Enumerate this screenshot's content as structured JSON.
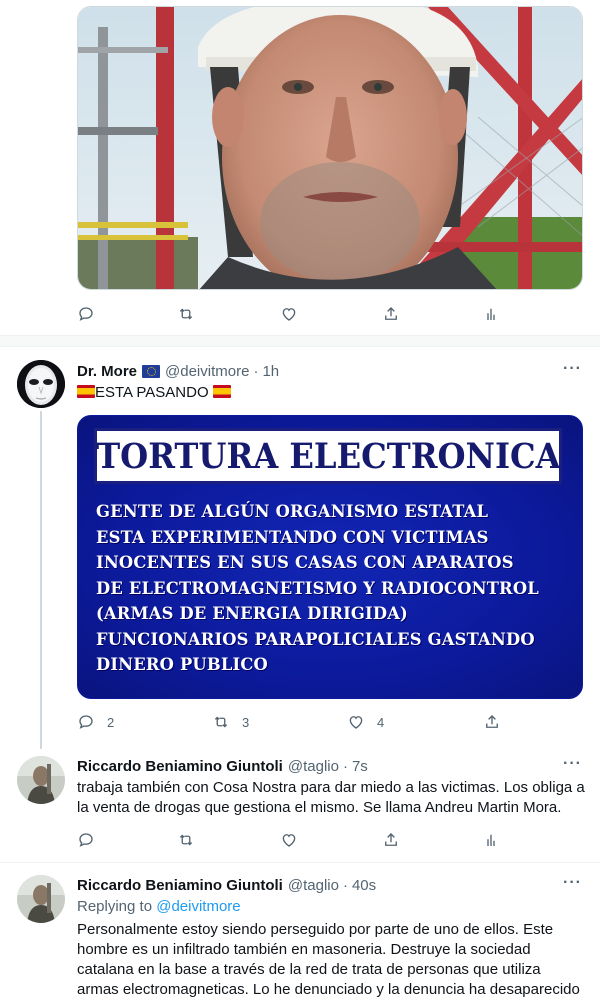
{
  "tweet_top": {
    "photo": "selfie-man-with-hardhat-near-antenna-tower",
    "actions": {
      "reply": "",
      "retweet": "",
      "like": ""
    }
  },
  "tweet_main": {
    "name": "Dr. More",
    "handle": "@deivitmore",
    "time": "1h",
    "text": "ESTA PASANDO",
    "image": {
      "title": "TORTURA ELECTRONICA",
      "lines": [
        "GENTE DE ALGÚN ORGANISMO ESTATAL",
        "ESTA EXPERIMENTANDO CON VICTIMAS",
        "INOCENTES EN SUS CASAS CON APARATOS",
        "DE ELECTROMAGNETISMO Y RADIOCONTROL",
        "(ARMAS DE ENERGIA DIRIGIDA)",
        "FUNCIONARIOS PARAPOLICIALES GASTANDO",
        "DINERO PUBLICO"
      ]
    },
    "actions": {
      "reply": "2",
      "retweet": "3",
      "like": "4"
    }
  },
  "tweet_reply1": {
    "name": "Riccardo Beniamino Giuntoli",
    "handle": "@taglio",
    "time": "7s",
    "text": "trabaja también con Cosa Nostra para dar miedo a las victimas. Los obliga a la venta de drogas que gestiona el mismo. Se llama Andreu Martin Mora."
  },
  "tweet_reply2": {
    "name": "Riccardo Beniamino Giuntoli",
    "handle": "@taglio",
    "time": "40s",
    "replying_prefix": "Replying to",
    "replying_to": "@deivitmore",
    "text": "Personalmente estoy siendo perseguido por parte de uno de ellos. Este hombre es un infiltrado también en masoneria. Destruye la sociedad catalana en la base a través de la red de trata de personas que utiliza armas electromagneticas. Lo he denunciado y la denuncia ha desaparecido"
  },
  "colors": {
    "accent": "#1d9bf0",
    "secondary_text": "#536471",
    "image_background": "#0c1a9c"
  },
  "icons": [
    "reply-icon",
    "retweet-icon",
    "like-icon",
    "share-icon",
    "analytics-icon",
    "more-icon"
  ]
}
